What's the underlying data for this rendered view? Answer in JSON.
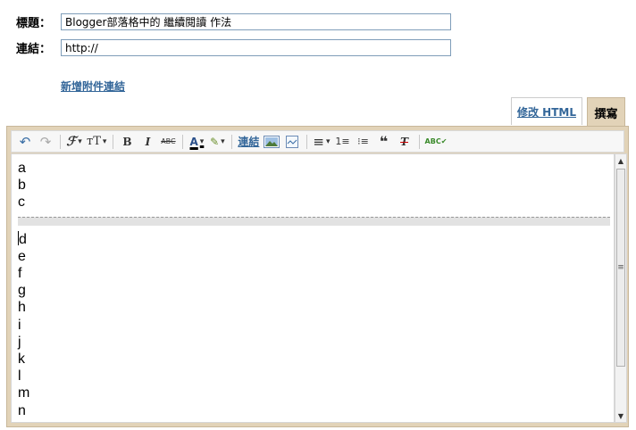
{
  "form": {
    "title_label": "標題：",
    "title_value": "Blogger部落格中的 繼續閱讀 作法",
    "url_label": "連結：",
    "url_value": "http://",
    "add_attachment_link": "新增附件連結"
  },
  "tabs": {
    "edit_html": "修改 HTML",
    "compose": "撰寫"
  },
  "toolbar": {
    "undo": "↶",
    "redo": "↷",
    "font": "ℱ",
    "font_size": "тT",
    "bold": "B",
    "italic": "I",
    "strike": "ABC",
    "text_color": "A",
    "highlight": "✎",
    "link_label": "連結",
    "align": "≡",
    "numbered_list": "1≡",
    "bullet_list": "⁝≡",
    "quote": "❝",
    "remove_format": "T",
    "spellcheck": "ABC✔"
  },
  "editor": {
    "lines_before_break": [
      "a",
      "b",
      "c"
    ],
    "lines_after_break": [
      "d",
      "e",
      "f",
      "g",
      "h",
      "i",
      "j",
      "k",
      "l",
      "m",
      "n"
    ]
  },
  "colors": {
    "frame": "#e2d3b8",
    "link": "#336699"
  }
}
